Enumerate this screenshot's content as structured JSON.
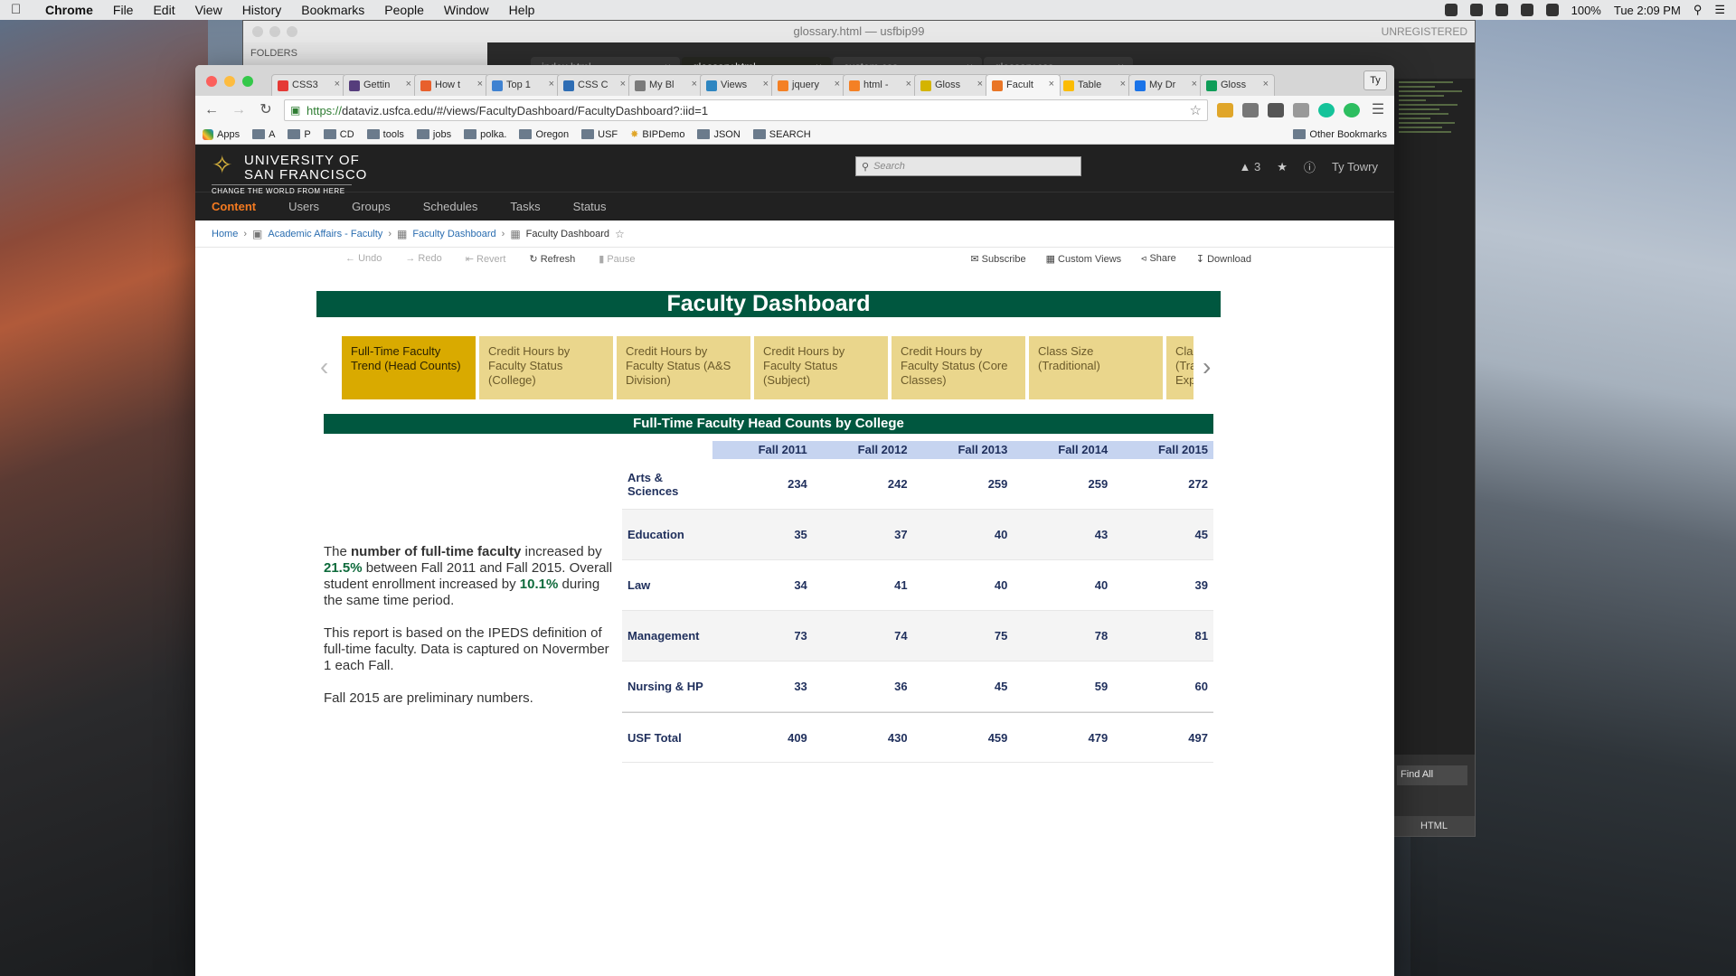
{
  "menubar": {
    "items": [
      "Chrome",
      "File",
      "Edit",
      "View",
      "History",
      "Bookmarks",
      "People",
      "Window",
      "Help"
    ],
    "battery": "100%",
    "clock": "Tue 2:09 PM"
  },
  "sublime": {
    "title": "glossary.html — usfbip99",
    "unregistered": "UNREGISTERED",
    "folders_label": "FOLDERS",
    "tabs": [
      "index.html",
      "glossary.html",
      "custom.css",
      "glossary.css"
    ],
    "find_all": "Find All",
    "syntax": "HTML"
  },
  "chrome": {
    "tabs": [
      {
        "label": "CSS3",
        "color": "#e53935"
      },
      {
        "label": "Gettin",
        "color": "#563d7c"
      },
      {
        "label": "How t",
        "color": "#e8602c"
      },
      {
        "label": "Top 1",
        "color": "#3f82d1"
      },
      {
        "label": "CSS C",
        "color": "#2e6db4"
      },
      {
        "label": "My Bl",
        "color": "#7a7a7a"
      },
      {
        "label": "Views",
        "color": "#2e86c1"
      },
      {
        "label": "jquery",
        "color": "#f48024"
      },
      {
        "label": "html -",
        "color": "#f48024"
      },
      {
        "label": "Gloss",
        "color": "#d4b400"
      },
      {
        "label": "Facult",
        "color": "#e97627"
      },
      {
        "label": "Table",
        "color": "#fbbc04"
      },
      {
        "label": "My Dr",
        "color": "#1a73e8"
      },
      {
        "label": "Gloss",
        "color": "#0f9d58"
      }
    ],
    "active_tab": 10,
    "profile": "Ty",
    "url_https": "https://",
    "url_rest": "dataviz.usfca.edu/#/views/FacultyDashboard/FacultyDashboard?:iid=1",
    "bookmarks": [
      "Apps",
      "A",
      "P",
      "CD",
      "tools",
      "jobs",
      "polka.",
      "Oregon",
      "USF",
      "BIPDemo",
      "JSON",
      "SEARCH"
    ],
    "other_bookmarks": "Other Bookmarks"
  },
  "tableau": {
    "logo_line1": "UNIVERSITY OF",
    "logo_line2": "SAN FRANCISCO",
    "logo_tagline": "CHANGE THE WORLD FROM HERE",
    "search_placeholder": "Search",
    "alerts_count": "3",
    "user": "Ty Towry",
    "nav": [
      "Content",
      "Users",
      "Groups",
      "Schedules",
      "Tasks",
      "Status"
    ],
    "breadcrumbs": [
      "Home",
      "Academic Affairs - Faculty",
      "Faculty Dashboard",
      "Faculty Dashboard"
    ],
    "tools_left": [
      "Undo",
      "Redo",
      "Revert",
      "Refresh",
      "Pause"
    ],
    "tools_right": [
      "Subscribe",
      "Custom Views",
      "Share",
      "Download"
    ]
  },
  "dashboard": {
    "title": "Faculty Dashboard",
    "tabs": [
      "Full-Time Faculty Trend (Head Counts)",
      "Credit Hours by Faculty Status (College)",
      "Credit Hours by Faculty Status (A&S Division)",
      "Credit Hours by Faculty Status (Subject)",
      "Credit Hours by Faculty Status (Core Classes)",
      "Class Size (Traditional)",
      "Cla (Tra Exp"
    ],
    "sheet_title": "Full-Time Faculty Head Counts by College",
    "narrative": {
      "p1_a": "The ",
      "p1_b": "number of full-time faculty",
      "p1_c": " increased by ",
      "p1_d": "21.5%",
      "p1_e": " between Fall 2011 and Fall 2015. Overall student enrollment increased by ",
      "p1_f": "10.1%",
      "p1_g": " during the same time period.",
      "p2": "This report is based on the IPEDS definition of full-time faculty. Data is captured on Novermber 1 each Fall.",
      "p3": "Fall 2015 are preliminary numbers."
    }
  },
  "chart_data": {
    "type": "table",
    "title": "Full-Time Faculty Head Counts by College",
    "columns": [
      "Fall 2011",
      "Fall 2012",
      "Fall 2013",
      "Fall 2014",
      "Fall 2015"
    ],
    "rows": [
      {
        "label": "Arts & Sciences",
        "values": [
          234,
          242,
          259,
          259,
          272
        ]
      },
      {
        "label": "Education",
        "values": [
          35,
          37,
          40,
          43,
          45
        ]
      },
      {
        "label": "Law",
        "values": [
          34,
          41,
          40,
          40,
          39
        ]
      },
      {
        "label": "Management",
        "values": [
          73,
          74,
          75,
          78,
          81
        ]
      },
      {
        "label": "Nursing & HP",
        "values": [
          33,
          36,
          45,
          59,
          60
        ]
      },
      {
        "label": "USF Total",
        "values": [
          409,
          430,
          459,
          479,
          497
        ]
      }
    ]
  }
}
